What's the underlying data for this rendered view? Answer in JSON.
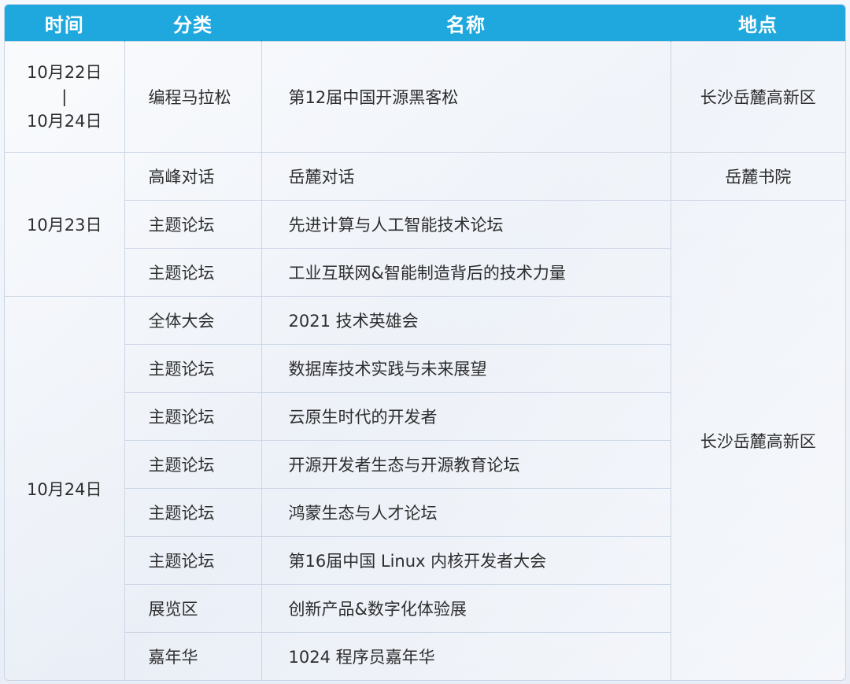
{
  "header": {
    "col_time": "时间",
    "col_category": "分类",
    "col_name": "名称",
    "col_location": "地点"
  },
  "rows": [
    {
      "time_lines": [
        "10月22日",
        "|",
        "10月24日"
      ],
      "category": "编程马拉松",
      "name": "第12届中国开源黑客松",
      "location": "长沙岳麓高新区"
    },
    {
      "time": "10月23日",
      "category": "高峰对话",
      "name": "岳麓对话",
      "location": "岳麓书院"
    },
    {
      "category": "主题论坛",
      "name": "先进计算与人工智能技术论坛",
      "location": "长沙岳麓高新区"
    },
    {
      "category": "主题论坛",
      "name": "工业互联网&智能制造背后的技术力量"
    },
    {
      "time": "10月24日",
      "category": "全体大会",
      "name": "2021 技术英雄会"
    },
    {
      "category": "主题论坛",
      "name": "数据库技术实践与未来展望"
    },
    {
      "category": "主题论坛",
      "name": "云原生时代的开发者"
    },
    {
      "category": "主题论坛",
      "name": "开源开发者生态与开源教育论坛"
    },
    {
      "category": "主题论坛",
      "name": "鸿蒙生态与人才论坛"
    },
    {
      "category": "主题论坛",
      "name": "第16届中国 Linux 内核开发者大会"
    },
    {
      "category": "展览区",
      "name": "创新产品&数字化体验展"
    },
    {
      "category": "嘉年华",
      "name": "1024 程序员嘉年华"
    }
  ],
  "colors": {
    "header_bg": "#1fa8dd",
    "header_text": "#ffffff",
    "border": "#ccd6e4"
  }
}
